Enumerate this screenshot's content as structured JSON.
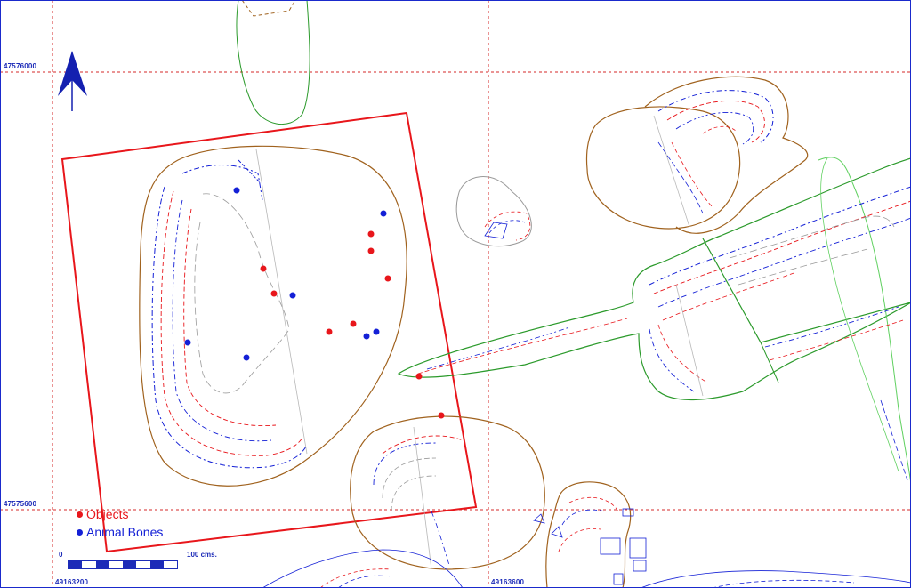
{
  "grid": {
    "northings": [
      "47576000",
      "47575600"
    ],
    "eastings": [
      "49163200",
      "49163600"
    ]
  },
  "legend": {
    "objects_label": "Objects",
    "animal_bones_label": "Animal Bones"
  },
  "scale": {
    "start_label": "0",
    "end_label": "100 cms."
  },
  "colors": {
    "objects": "#e8161b",
    "animal_bones": "#1420d6",
    "grid": "#d62a2a",
    "excavation_frame": "#e8161b",
    "feature_outline_brown": "#a0621e",
    "feature_outline_green": "#2b9a2b",
    "north_arrow": "#1420b0"
  },
  "icons": {
    "north_arrow": "north-arrow-icon"
  }
}
